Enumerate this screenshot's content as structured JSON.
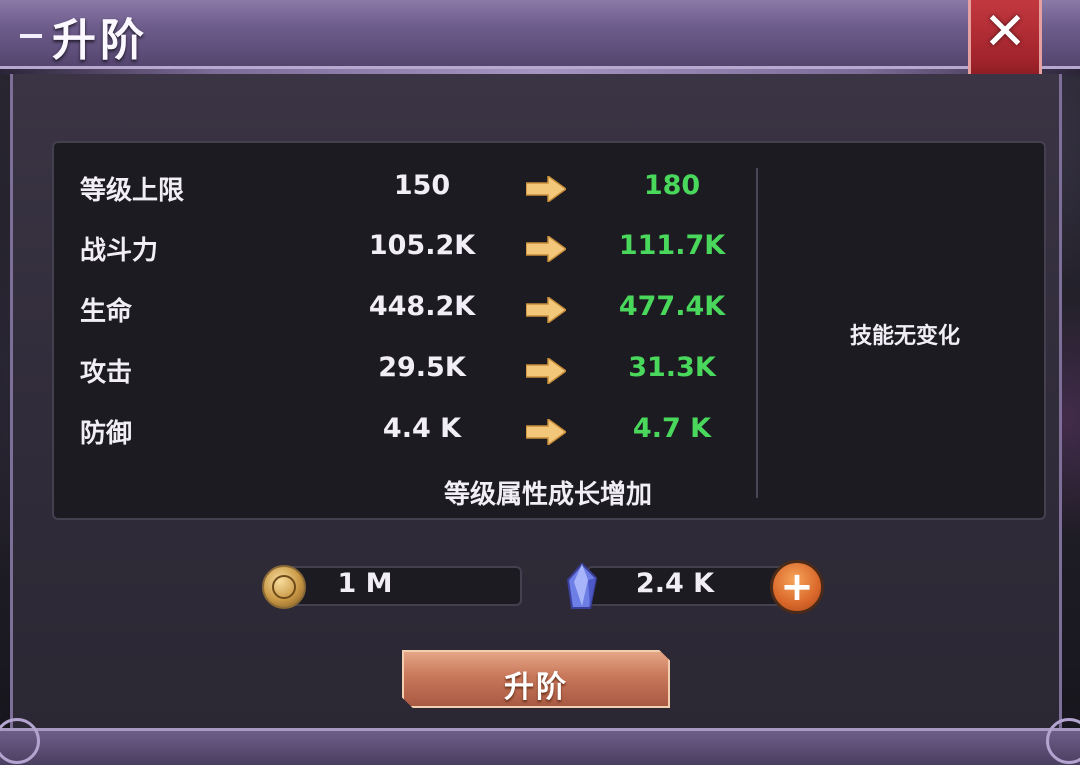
{
  "header": {
    "title": "升阶",
    "close_icon": "close-icon"
  },
  "stats": [
    {
      "label": "等级上限",
      "old": "150",
      "new": "180"
    },
    {
      "label": "战斗力",
      "old": "105.2K",
      "new": "111.7K"
    },
    {
      "label": "生命",
      "old": "448.2K",
      "new": "477.4K"
    },
    {
      "label": "攻击",
      "old": "29.5K",
      "new": "31.3K"
    },
    {
      "label": "防御",
      "old": "4.4 K",
      "new": "4.7 K"
    }
  ],
  "growth_note": "等级属性成长增加",
  "skill_note": "技能无变化",
  "resources": {
    "gold": {
      "icon": "gold-coin-icon",
      "value": "1 M"
    },
    "crystal": {
      "icon": "crystal-icon",
      "value": "2.4 K",
      "add_label": "+"
    }
  },
  "upgrade_button": {
    "label": "升阶"
  },
  "colors": {
    "increase": "#49d85c",
    "accent": "#d9672a"
  }
}
